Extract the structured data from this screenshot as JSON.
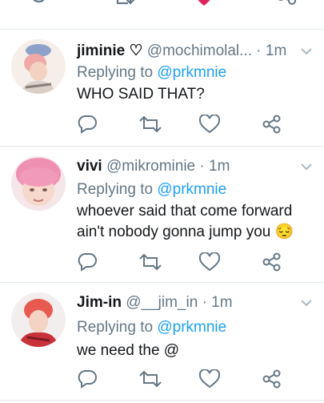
{
  "tweets": [
    {
      "display_name": "jiminie ♡",
      "handle": "@mochimolal...",
      "time": "· 1m",
      "replying_prefix": "Replying to",
      "replying_to": "@prkmnie",
      "text": "WHO SAID THAT?"
    },
    {
      "display_name": "vivi",
      "handle": "@mikrominie",
      "time": "· 1m",
      "replying_prefix": "Replying to",
      "replying_to": "@prkmnie",
      "text": "whoever said that come forward\nain't nobody gonna jump you 😔"
    },
    {
      "display_name": "Jim-in",
      "handle": "@__jim_in",
      "time": "· 1m",
      "replying_prefix": "Replying to",
      "replying_to": "@prkmnie",
      "text": "we need the @"
    }
  ],
  "colors": {
    "icon_gray": "#657786",
    "link_blue": "#1da1f2",
    "like_active": "#e0245e",
    "divider": "#e1e8ed"
  },
  "icons": [
    "reply-icon",
    "retweet-icon",
    "like-icon",
    "share-icon",
    "chevron-down-icon"
  ]
}
